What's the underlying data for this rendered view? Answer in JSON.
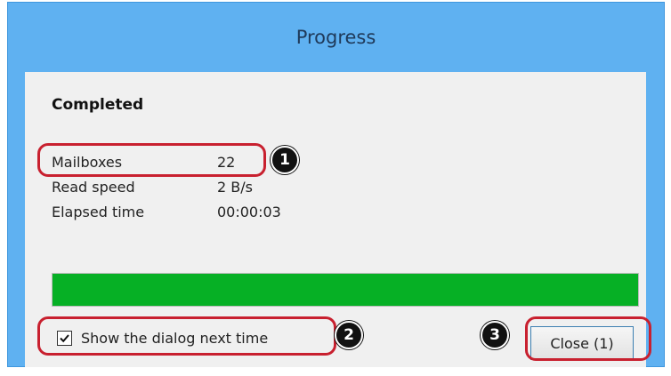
{
  "dialog": {
    "title": "Progress",
    "status": "Completed",
    "stats": [
      {
        "label": "Mailboxes",
        "value": "22"
      },
      {
        "label": "Read speed",
        "value": "2 B/s"
      },
      {
        "label": "Elapsed time",
        "value": "00:00:03"
      }
    ],
    "progress_percent": 100,
    "progress_color": "#06b025",
    "show_dialog_next_time": {
      "label": "Show the dialog next time",
      "checked": true
    },
    "close_button_label": "Close (1)"
  },
  "annotations": {
    "callout_color": "#c8202f",
    "markers": [
      "1",
      "2",
      "3"
    ]
  }
}
